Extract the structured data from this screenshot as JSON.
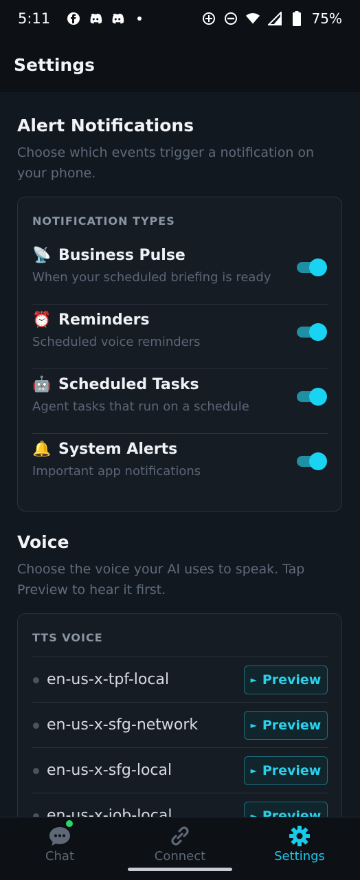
{
  "status_bar": {
    "time": "5:11",
    "battery": "75%"
  },
  "app_bar": {
    "title": "Settings"
  },
  "alerts": {
    "title": "Alert Notifications",
    "description": "Choose which events trigger a notification on your phone.",
    "card_label": "NOTIFICATION TYPES",
    "items": [
      {
        "emoji": "📡",
        "title": "Business Pulse",
        "desc": "When your scheduled briefing is ready",
        "enabled": true
      },
      {
        "emoji": "⏰",
        "title": "Reminders",
        "desc": "Scheduled voice reminders",
        "enabled": true
      },
      {
        "emoji": "🤖",
        "title": "Scheduled Tasks",
        "desc": "Agent tasks that run on a schedule",
        "enabled": true
      },
      {
        "emoji": "🔔",
        "title": "System Alerts",
        "desc": "Important app notifications",
        "enabled": true
      }
    ]
  },
  "voice": {
    "title": "Voice",
    "description": "Choose the voice your AI uses to speak. Tap Preview to hear it first.",
    "card_label": "TTS VOICE",
    "preview_label": "Preview",
    "voices": [
      {
        "name": "en-us-x-tpf-local"
      },
      {
        "name": "en-us-x-sfg-network"
      },
      {
        "name": "en-us-x-sfg-local"
      },
      {
        "name": "en-us-x-iob-local"
      }
    ]
  },
  "bottom_nav": {
    "items": [
      {
        "label": "Chat",
        "icon": "chat-bubble-icon"
      },
      {
        "label": "Connect",
        "icon": "link-icon"
      },
      {
        "label": "Settings",
        "icon": "gear-icon",
        "active": true
      }
    ]
  },
  "colors": {
    "accent": "#19d3f2",
    "background": "#121820",
    "card": "#161c24"
  }
}
